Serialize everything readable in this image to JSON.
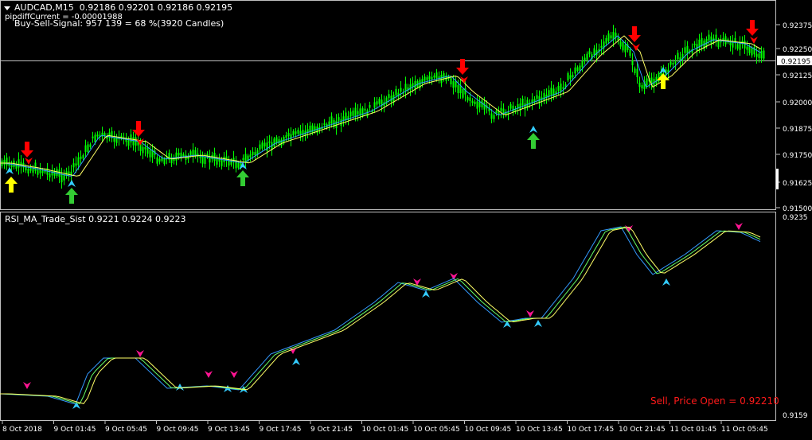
{
  "main": {
    "symbol": "AUDCAD,M15",
    "ohlc": "0.92186 0.92201 0.92186 0.92195",
    "pipdiff": "pipdiffCurrent = -0.00001988",
    "signal": "Buy-Sell-Signal: 957 139 = 68 %(3920 Candles)",
    "price_labels": [
      "0.92375",
      "0.92250",
      "0.92125",
      "0.92000",
      "0.91875",
      "0.91750",
      "0.91625",
      "0.91500"
    ],
    "current_price": "0.92195"
  },
  "sub": {
    "label": "RSI_MA_Trade_Sist 0.9221 0.9224 0.9223",
    "top_value": "0.9235",
    "bottom_value": "0.9159",
    "sell_text": "Sell, Price Open = 0.92210"
  },
  "time_labels": [
    "8 Oct 2018",
    "9 Oct 01:45",
    "9 Oct 05:45",
    "9 Oct 09:45",
    "9 Oct 13:45",
    "9 Oct 17:45",
    "9 Oct 21:45",
    "10 Oct 01:45",
    "10 Oct 05:45",
    "10 Oct 09:45",
    "10 Oct 13:45",
    "10 Oct 17:45",
    "10 Oct 21:45",
    "11 Oct 01:45",
    "11 Oct 05:45"
  ],
  "colors": {
    "background": "#000000",
    "grid_line": "#c0c0c0",
    "candle": "#00ff00",
    "ma_fast": "#3399ff",
    "ma_slow": "#ffff66",
    "arrow_buy_yellow": "#ffff00",
    "arrow_buy_green": "#33cc33",
    "arrow_sell": "#ff0000",
    "marker_up": "#33ccff",
    "marker_down": "#ff1493",
    "sell_text": "#ff1a1a"
  },
  "icons": {
    "symbol_menu": "triangle-down-icon",
    "buy": "arrow-up-icon",
    "sell": "arrow-down-icon"
  }
}
